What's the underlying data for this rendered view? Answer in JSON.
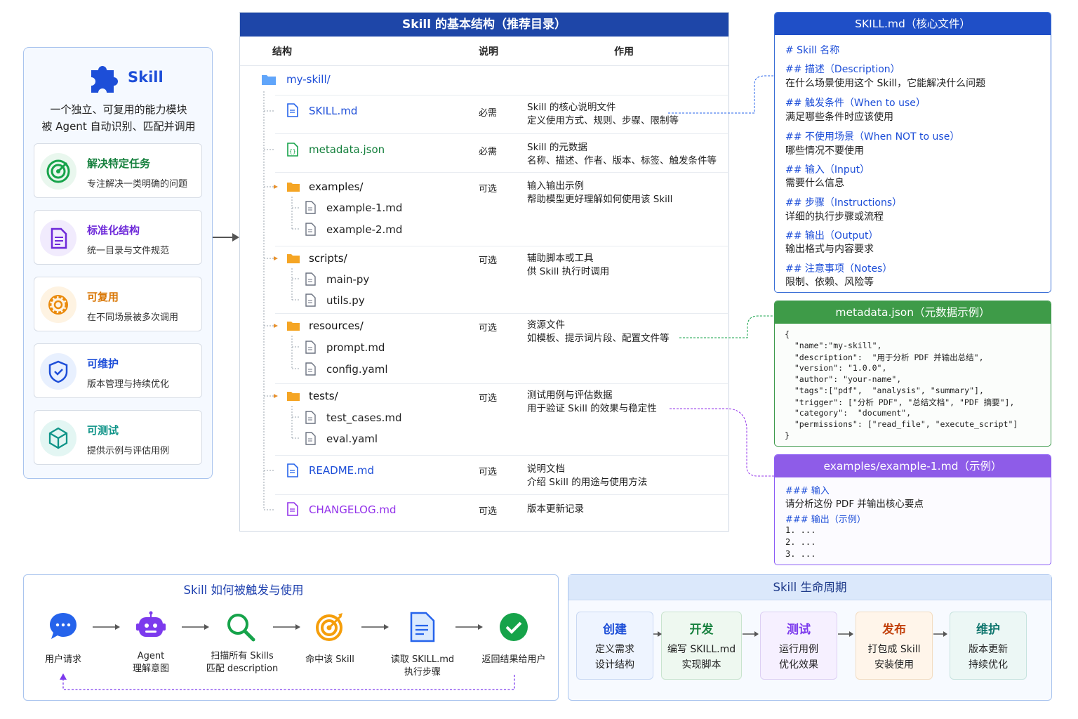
{
  "intro": {
    "title": "Skill",
    "line1": "一个独立、可复用的能力模块",
    "line2": "被 Agent 自动识别、匹配并调用"
  },
  "features": [
    {
      "title": "解决特定任务",
      "desc": "专注解决一类明确的问题",
      "color": "#15803d"
    },
    {
      "title": "标准化结构",
      "desc": "统一目录与文件规范",
      "color": "#6d28d9"
    },
    {
      "title": "可复用",
      "desc": "在不同场景被多次调用",
      "color": "#d97706"
    },
    {
      "title": "可维护",
      "desc": "版本管理与持续优化",
      "color": "#1d4ed8"
    },
    {
      "title": "可测试",
      "desc": "提供示例与评估用例",
      "color": "#0f9488"
    }
  ],
  "tree": {
    "title": "Skill 的基本结构（推荐目录）",
    "col_structure": "结构",
    "col_note": "说明",
    "col_purpose": "作用",
    "root": "my-skill/",
    "entries": [
      {
        "name": "SKILL.md",
        "req": "必需",
        "desc1": "Skill 的核心说明文件",
        "desc2": "定义使用方式、规则、步骤、限制等"
      },
      {
        "name": "metadata.json",
        "req": "必需",
        "desc1": "Skill 的元数据",
        "desc2": "名称、描述、作者、版本、标签、触发条件等"
      },
      {
        "name": "examples/",
        "req": "可选",
        "desc1": "输入输出示例",
        "desc2": "帮助模型更好理解如何使用该 Skill",
        "children": [
          "example-1.md",
          "example-2.md"
        ]
      },
      {
        "name": "scripts/",
        "req": "可选",
        "desc1": "辅助脚本或工具",
        "desc2": "供 Skill 执行时调用",
        "children": [
          "main-py",
          "utils.py"
        ]
      },
      {
        "name": "resources/",
        "req": "可选",
        "desc1": "资源文件",
        "desc2": "如模板、提示词片段、配置文件等",
        "children": [
          "prompt.md",
          "config.yaml"
        ]
      },
      {
        "name": "tests/",
        "req": "可选",
        "desc1": "测试用例与评估数据",
        "desc2": "用于验证 Skill 的效果与稳定性",
        "children": [
          "test_cases.md",
          "eval.yaml"
        ]
      },
      {
        "name": "README.md",
        "req": "可选",
        "desc1": "说明文档",
        "desc2": "介绍 Skill 的用途与使用方法"
      },
      {
        "name": "CHANGELOG.md",
        "req": "可选",
        "desc1": "版本更新记录",
        "desc2": ""
      }
    ]
  },
  "skill_md": {
    "title": "SKILL.md（核心文件）",
    "items": [
      {
        "h": "# Skill 名称",
        "d": ""
      },
      {
        "h": "## 描述（Description）",
        "d": "在什么场景使用这个 Skill，它能解决什么问题"
      },
      {
        "h": "## 触发条件（When to use）",
        "d": "满足哪些条件时应该使用"
      },
      {
        "h": "## 不使用场景（When NOT to use）",
        "d": "哪些情况不要使用"
      },
      {
        "h": "## 输入（Input）",
        "d": "需要什么信息"
      },
      {
        "h": "## 步骤（Instructions）",
        "d": "详细的执行步骤或流程"
      },
      {
        "h": "## 输出（Output）",
        "d": "输出格式与内容要求"
      },
      {
        "h": "## 注意事项（Notes）",
        "d": "限制、依赖、风险等"
      }
    ]
  },
  "metadata_json": {
    "title": "metadata.json（元数据示例）",
    "lines": [
      "{",
      "  \"name\":\"my-skill\",",
      "  \"description\":  \"用于分析 PDF 并输出总结\",",
      "  \"version\": \"1.0.0\",",
      "  \"author\": \"your-name\",",
      "  \"tags\":[\"pdf\",  \"analysis\", \"summary\"],",
      "  \"trigger\": [\"分析 PDF\", \"总结文档\", \"PDF 摘要\"],",
      "  \"category\":  \"document\",",
      "  \"permissions\": [\"read_file\", \"execute_script\"]",
      "}"
    ]
  },
  "example_md": {
    "title": "examples/example-1.md（示例）",
    "in_h": "### 输入",
    "in_d": "请分析这份 PDF 并输出核心要点",
    "out_h": "### 输出（示例）",
    "out_lines": [
      "1. ...",
      "2. ...",
      "3. ..."
    ]
  },
  "flow": {
    "title": "Skill 如何被触发与使用",
    "steps": [
      {
        "l1": "用户请求",
        "l2": ""
      },
      {
        "l1": "Agent",
        "l2": "理解意图"
      },
      {
        "l1": "扫描所有 Skills",
        "l2": "匹配 description"
      },
      {
        "l1": "命中该 Skill",
        "l2": ""
      },
      {
        "l1": "读取 SKILL.md",
        "l2": "执行步骤"
      },
      {
        "l1": "返回结果给用户",
        "l2": ""
      }
    ]
  },
  "lifecycle": {
    "title": "Skill 生命周期",
    "stages": [
      {
        "t": "创建",
        "d1": "定义需求",
        "d2": "设计结构",
        "color": "#1d4ed8"
      },
      {
        "t": "开发",
        "d1": "编写 SKILL.md",
        "d2": "实现脚本",
        "color": "#15803d"
      },
      {
        "t": "测试",
        "d1": "运行用例",
        "d2": "优化效果",
        "color": "#7c3aed"
      },
      {
        "t": "发布",
        "d1": "打包成 Skill",
        "d2": "安装使用",
        "color": "#c2410c"
      },
      {
        "t": "维护",
        "d1": "版本更新",
        "d2": "持续优化",
        "color": "#0f766e"
      }
    ]
  }
}
